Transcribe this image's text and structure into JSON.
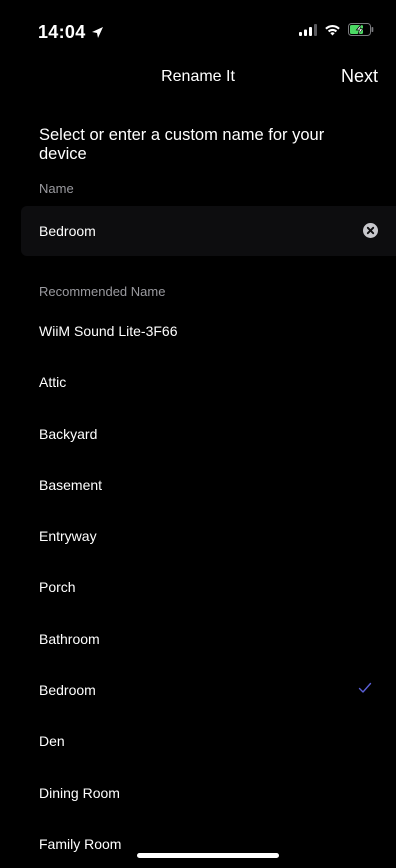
{
  "status_bar": {
    "time": "14:04"
  },
  "nav": {
    "title": "Rename It",
    "next_label": "Next"
  },
  "heading": "Select or enter a custom name for your device",
  "name_section": {
    "label": "Name",
    "value": "Bedroom"
  },
  "recommended": {
    "label": "Recommended Name",
    "items": [
      {
        "label": "WiiM Sound Lite-3F66"
      },
      {
        "label": "Attic"
      },
      {
        "label": "Backyard"
      },
      {
        "label": "Basement"
      },
      {
        "label": "Entryway"
      },
      {
        "label": "Porch"
      },
      {
        "label": "Bathroom"
      },
      {
        "label": "Bedroom",
        "selected": true
      },
      {
        "label": "Den"
      },
      {
        "label": "Dining Room"
      },
      {
        "label": "Family Room"
      }
    ]
  },
  "colors": {
    "background": "#000000",
    "field_background": "#0d0d0f",
    "secondary_text": "#9a9a9f",
    "check_accent": "#5a5fd6",
    "battery_charging": "#4cd964"
  }
}
